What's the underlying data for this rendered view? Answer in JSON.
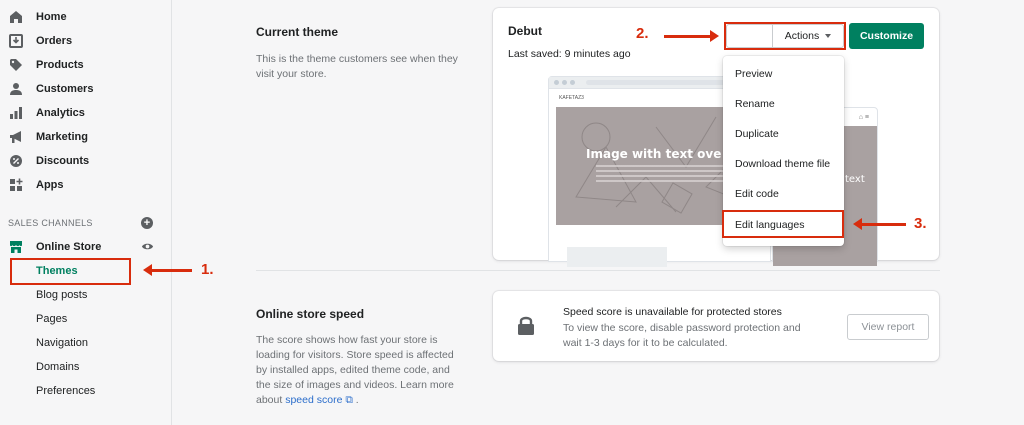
{
  "sidebar": {
    "nav": [
      {
        "label": "Home",
        "icon": "home-icon"
      },
      {
        "label": "Orders",
        "icon": "orders-icon"
      },
      {
        "label": "Products",
        "icon": "tag-icon"
      },
      {
        "label": "Customers",
        "icon": "person-icon"
      },
      {
        "label": "Analytics",
        "icon": "bar-chart-icon"
      },
      {
        "label": "Marketing",
        "icon": "megaphone-icon"
      },
      {
        "label": "Discounts",
        "icon": "discount-icon"
      },
      {
        "label": "Apps",
        "icon": "apps-icon"
      }
    ],
    "sales_channels_label": "SALES CHANNELS",
    "online_store_label": "Online Store",
    "sub_items": [
      "Themes",
      "Blog posts",
      "Pages",
      "Navigation",
      "Domains",
      "Preferences"
    ],
    "active_sub_item": "Themes"
  },
  "annotations": {
    "step1": "1.",
    "step2": "2.",
    "step3": "3."
  },
  "current_theme": {
    "title": "Current theme",
    "description": "This is the theme customers see when they visit your store.",
    "theme_name": "Debut",
    "last_saved": "Last saved: 9 minutes ago",
    "actions_label": "Actions",
    "customize_label": "Customize",
    "preview_hero_text": "Image with text ove",
    "preview_mobile_text": "text",
    "preview_logo": "KAFETAZ3"
  },
  "actions_menu": [
    "Preview",
    "Rename",
    "Duplicate",
    "Download theme file",
    "Edit code",
    "Edit languages"
  ],
  "speed": {
    "title": "Online store speed",
    "description_before_link": "The score shows how fast your store is loading for visitors. Store speed is affected by installed apps, edited theme code, and the size of images and videos. Learn more about",
    "link_text": "speed score",
    "description_after_link": " .",
    "card_title": "Speed score is unavailable for protected stores",
    "card_desc": "To view the score, disable password protection and wait 1-3 days for it to be calculated.",
    "view_report_label": "View report"
  },
  "colors": {
    "accent": "#008060",
    "annotation": "#d82c0d",
    "link": "#2c6ecb"
  }
}
